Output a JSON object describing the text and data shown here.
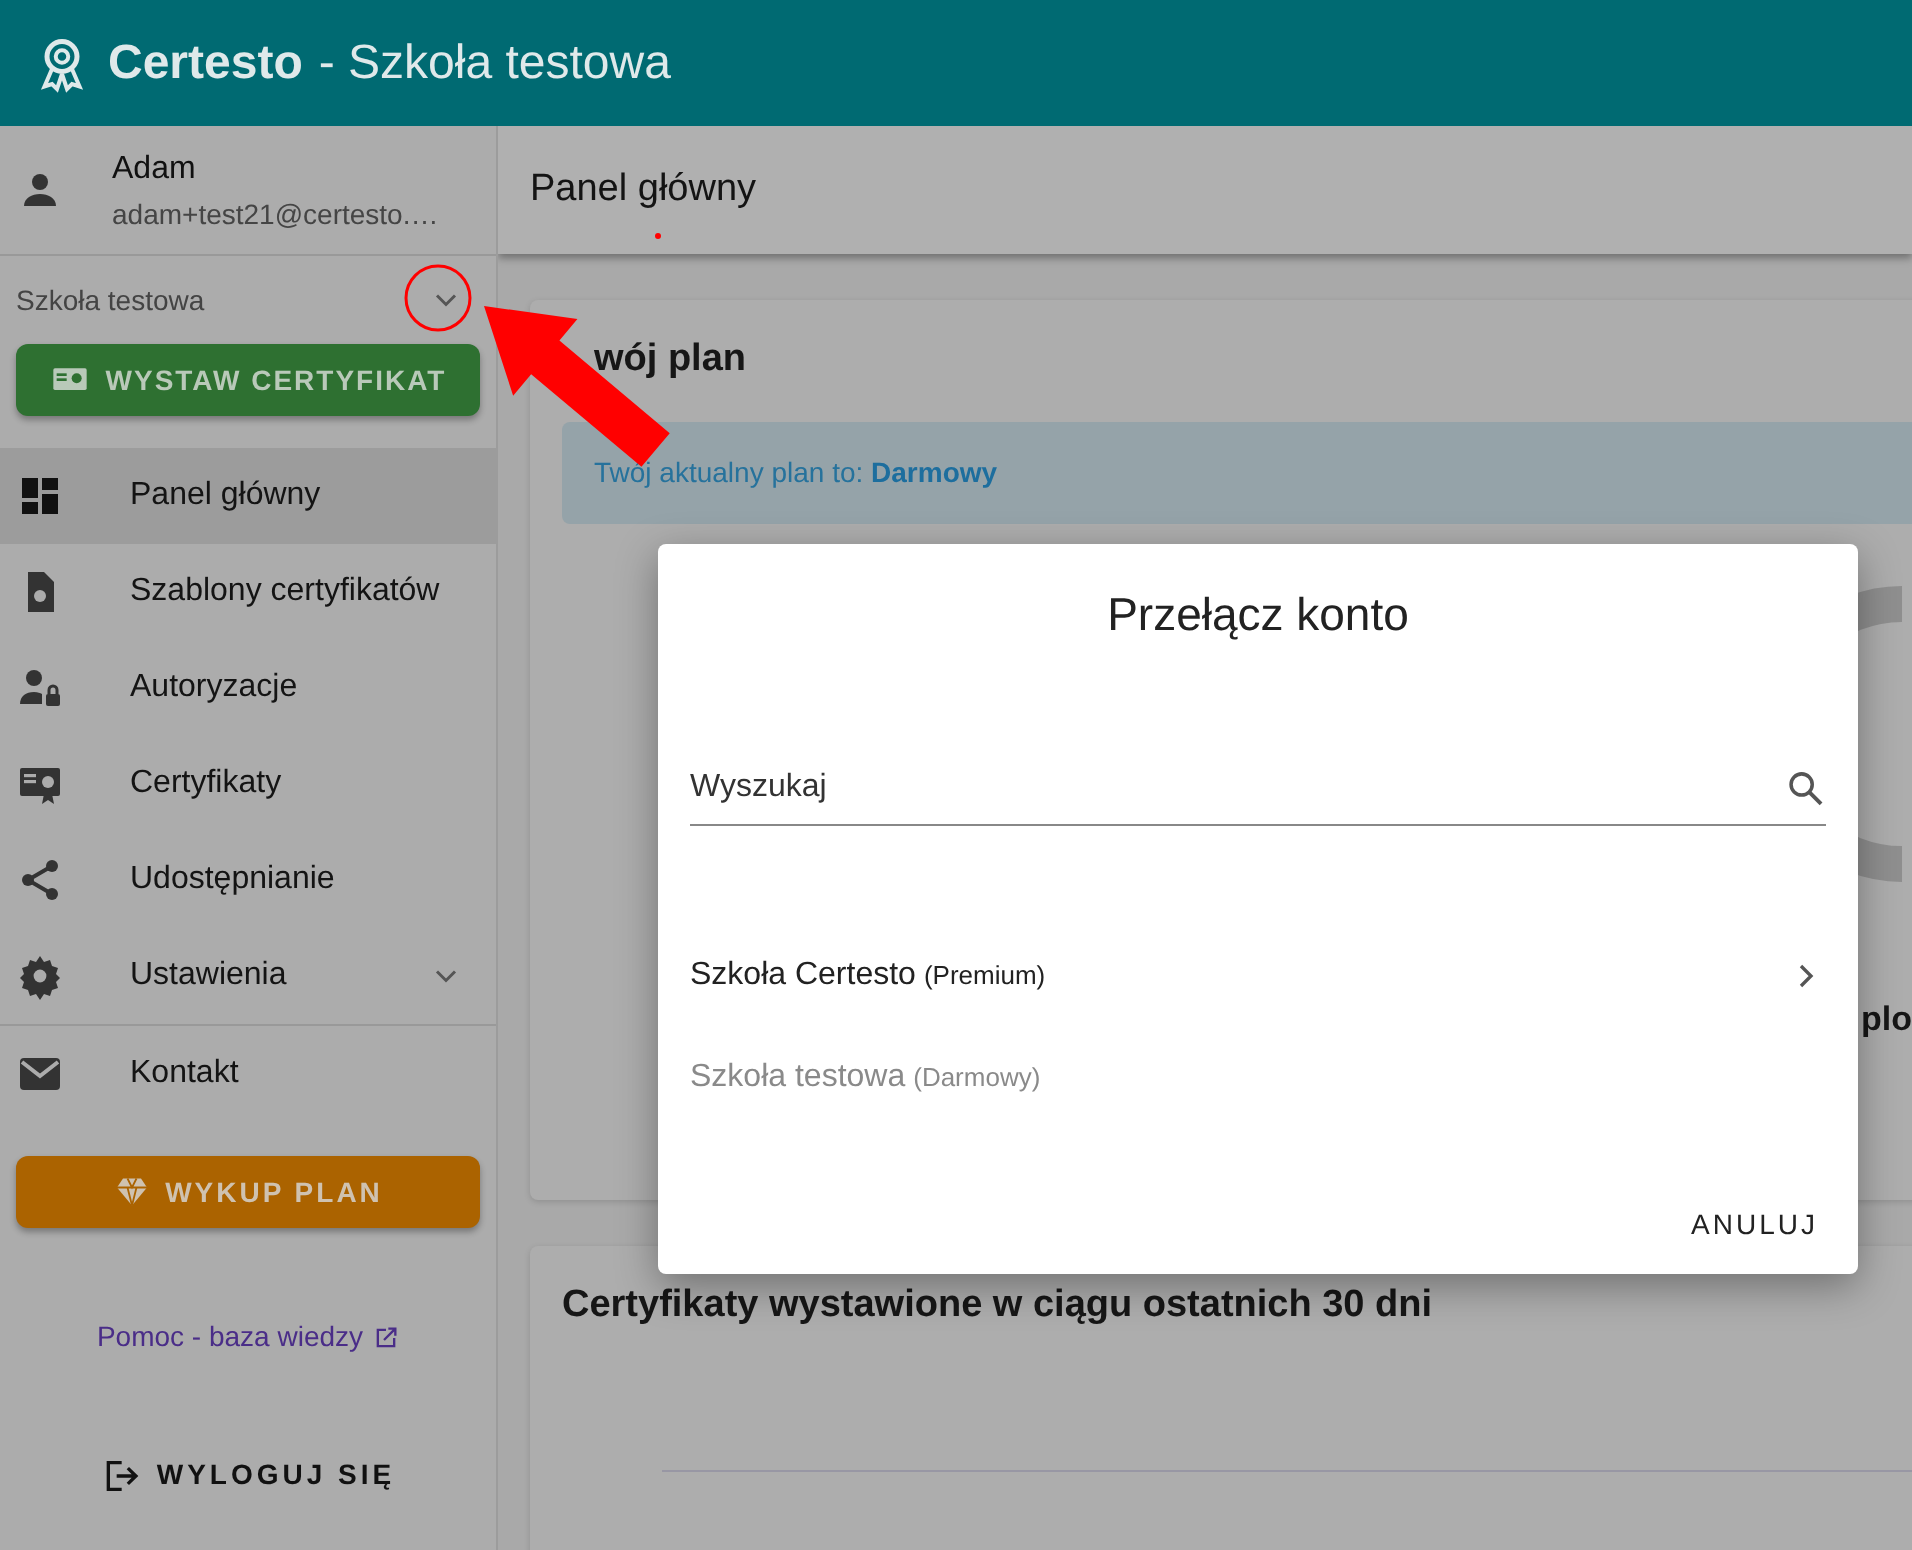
{
  "header": {
    "brand": "Certesto",
    "subtitle": "- Szkoła testowa"
  },
  "user": {
    "name": "Adam",
    "email": "adam+test21@certesto.…"
  },
  "account": {
    "name": "Szkoła testowa"
  },
  "issue_button": "WYSTAW CERTYFIKAT",
  "nav_groups": [
    {
      "items": [
        {
          "label": "Panel główny",
          "selected": true,
          "expandable": false
        },
        {
          "label": "Szablony certyfikatów",
          "selected": false,
          "expandable": false
        },
        {
          "label": "Autoryzacje",
          "selected": false,
          "expandable": false
        },
        {
          "label": "Certyfikaty",
          "selected": false,
          "expandable": false
        },
        {
          "label": "Udostępnianie",
          "selected": false,
          "expandable": false
        },
        {
          "label": "Ustawienia",
          "selected": false,
          "expandable": true
        }
      ]
    },
    {
      "items": [
        {
          "label": "Kontakt",
          "selected": false,
          "expandable": false
        }
      ]
    }
  ],
  "upgrade_button": "WYKUP PLAN",
  "help_link": "Pomoc - baza wiedzy",
  "logout_button": "WYLOGUJ SIĘ",
  "page_title": "Panel główny",
  "plan_card": {
    "title": "wój plan",
    "notice": "Twój aktualny plan to: **Darmowy**",
    "fragment": "plo"
  },
  "chart_card": {
    "title": "Certyfikaty wystawione w ciągu ostatnich 30 dni"
  },
  "dialog": {
    "title": "Przełącz konto",
    "search": {
      "placeholder": "Wyszukaj"
    },
    "accounts": [
      {
        "name": "Szkoła Certesto",
        "plan": "(Premium)",
        "disabled": false
      },
      {
        "name": "Szkoła testowa",
        "plan": "(Darmowy)",
        "disabled": true
      }
    ],
    "cancel": "ANULUJ"
  }
}
